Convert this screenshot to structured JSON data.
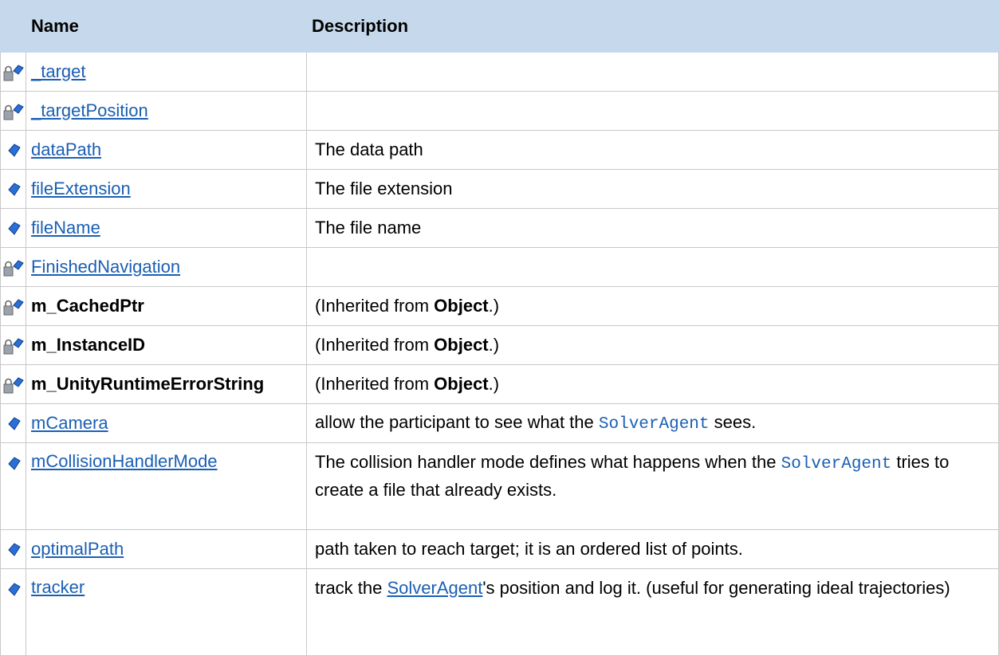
{
  "headers": {
    "name": "Name",
    "description": "Description"
  },
  "rows": [
    {
      "name": "_target",
      "icon": "protected-field-icon"
    },
    {
      "name": "_targetPosition",
      "icon": "protected-field-icon"
    },
    {
      "name": "dataPath",
      "icon": "public-field-icon",
      "desc": "The data path"
    },
    {
      "name": "fileExtension",
      "icon": "public-field-icon",
      "desc": "The file extension"
    },
    {
      "name": "fileName",
      "icon": "public-field-icon",
      "desc": "The file name"
    },
    {
      "name": "FinishedNavigation",
      "icon": "protected-field-icon"
    },
    {
      "name": "m_CachedPtr",
      "icon": "protected-field-icon",
      "desc_prefix": "(Inherited from ",
      "desc_bold": "Object",
      "desc_suffix": ".)"
    },
    {
      "name": "m_InstanceID",
      "icon": "protected-field-icon",
      "desc_prefix": "(Inherited from ",
      "desc_bold": "Object",
      "desc_suffix": ".)"
    },
    {
      "name": "m_UnityRuntimeErrorString",
      "icon": "protected-field-icon",
      "desc_prefix": "(Inherited from ",
      "desc_bold": "Object",
      "desc_suffix": ".)"
    },
    {
      "name": "mCamera",
      "icon": "public-field-icon",
      "desc_prefix": "allow the participant to see what the ",
      "desc_code": "SolverAgent",
      "desc_suffix": " sees."
    },
    {
      "name": "mCollisionHandlerMode",
      "icon": "public-field-icon",
      "desc_prefix": "The collision handler mode defines what happens when the ",
      "desc_code": "SolverAgent",
      "desc_suffix": " tries to create a file that already exists."
    },
    {
      "name": "optimalPath",
      "icon": "public-field-icon",
      "desc": "path taken to reach target; it is an ordered list of points."
    },
    {
      "name": "tracker",
      "icon": "public-field-icon",
      "desc_prefix": "track the ",
      "desc_link": "SolverAgent",
      "desc_suffix": "'s position and log it. (useful for generating ideal trajectories)"
    }
  ],
  "colors": {
    "header_bg": "#c6d9ec",
    "link": "#1a5fb4",
    "border": "#c8c8c8"
  }
}
